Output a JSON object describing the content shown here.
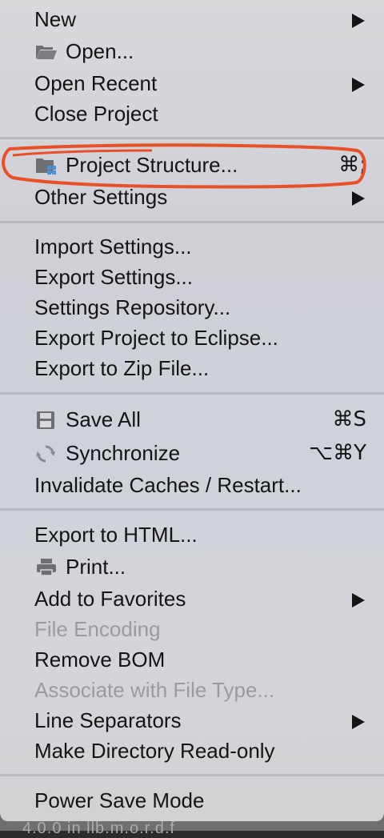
{
  "menu": {
    "new": {
      "label": "New"
    },
    "open": {
      "label": "Open...",
      "icon": "folder-icon"
    },
    "open_recent": {
      "label": "Open Recent"
    },
    "close_project": {
      "label": "Close Project"
    },
    "project_structure": {
      "label": "Project Structure...",
      "shortcut": "⌘;",
      "icon": "project-structure-icon"
    },
    "other_settings": {
      "label": "Other Settings"
    },
    "import_settings": {
      "label": "Import Settings..."
    },
    "export_settings": {
      "label": "Export Settings..."
    },
    "settings_repository": {
      "label": "Settings Repository..."
    },
    "export_eclipse": {
      "label": "Export Project to Eclipse..."
    },
    "export_zip": {
      "label": "Export to Zip File..."
    },
    "save_all": {
      "label": "Save All",
      "shortcut": "⌘S",
      "icon": "save-icon"
    },
    "synchronize": {
      "label": "Synchronize",
      "shortcut": "⌥⌘Y",
      "icon": "sync-icon"
    },
    "invalidate_caches": {
      "label": "Invalidate Caches / Restart..."
    },
    "export_html": {
      "label": "Export to HTML..."
    },
    "print": {
      "label": "Print...",
      "icon": "printer-icon"
    },
    "add_favorites": {
      "label": "Add to Favorites"
    },
    "file_encoding": {
      "label": "File Encoding"
    },
    "remove_bom": {
      "label": "Remove BOM"
    },
    "associate_file_type": {
      "label": "Associate with File Type..."
    },
    "line_separators": {
      "label": "Line Separators"
    },
    "make_readonly": {
      "label": "Make Directory Read-only"
    },
    "power_save": {
      "label": "Power Save Mode"
    }
  },
  "background_text": "4.0.0 in llb.m.o.r.d.f",
  "colors": {
    "annotation": "#e8502a",
    "text": "#141414",
    "disabled_text": "#9a9ba0",
    "separator": "#b8b9be"
  }
}
